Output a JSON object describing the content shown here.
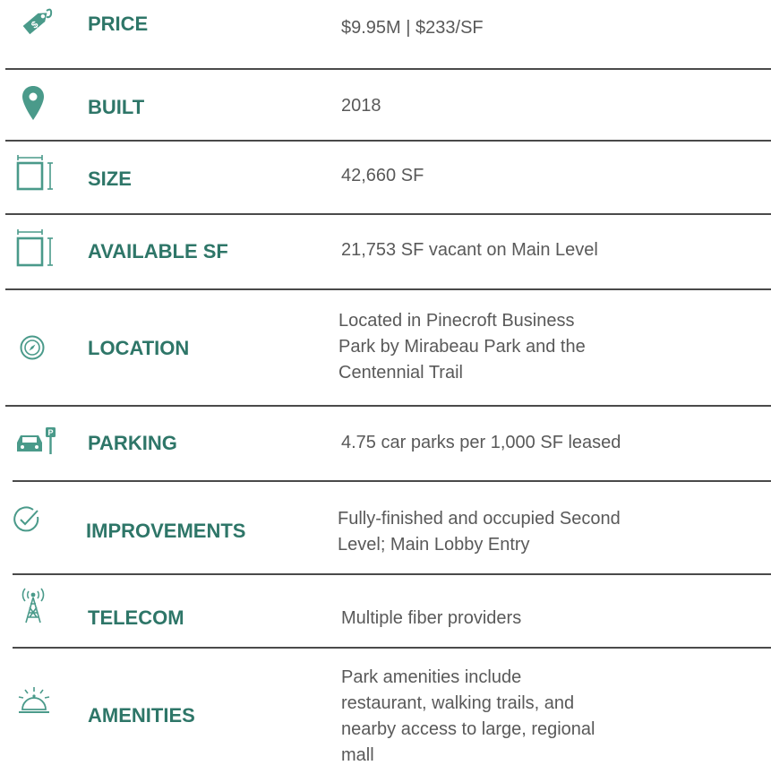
{
  "colors": {
    "accent": "#2e7668",
    "icon": "#4a9a8a",
    "text": "#595959",
    "divider": "#4a4a4a"
  },
  "rows": [
    {
      "icon": "price-tag-icon",
      "label": "PRICE",
      "value": [
        "$9.95M | $233/SF"
      ]
    },
    {
      "icon": "map-pin-icon",
      "label": "BUILT",
      "value": [
        "2018"
      ]
    },
    {
      "icon": "square-dimension-icon",
      "label": "SIZE",
      "value": [
        "42,660 SF"
      ]
    },
    {
      "icon": "square-dimension-icon",
      "label": "AVAILABLE SF",
      "value": [
        "21,753 SF vacant on Main Level"
      ]
    },
    {
      "icon": "compass-icon",
      "label": "LOCATION",
      "value": [
        "Located in Pinecroft Business",
        "Park by Mirabeau Park and the",
        "Centennial Trail"
      ]
    },
    {
      "icon": "car-parking-icon",
      "label": "PARKING",
      "value": [
        "4.75 car parks per 1,000 SF leased"
      ]
    },
    {
      "icon": "check-circle-icon",
      "label": "IMPROVEMENTS",
      "value": [
        "Fully-finished and occupied Second",
        "Level; Main Lobby Entry"
      ]
    },
    {
      "icon": "cell-tower-icon",
      "label": "TELECOM",
      "value": [
        "Multiple fiber providers"
      ]
    },
    {
      "icon": "service-bell-icon",
      "label": "AMENITIES",
      "value": [
        "Park amenities include",
        "restaurant, walking trails, and",
        "nearby access to large, regional",
        "mall"
      ]
    }
  ]
}
